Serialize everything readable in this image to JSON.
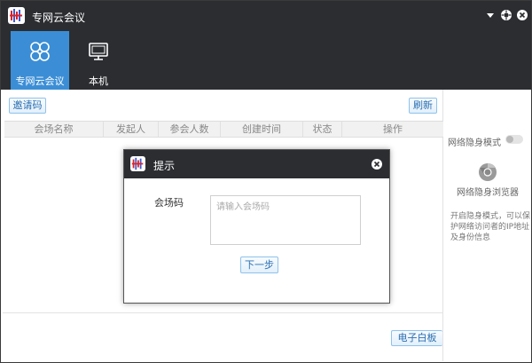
{
  "window": {
    "title": "专网云会议"
  },
  "nav": {
    "tabs": [
      {
        "label": "专网云会议",
        "icon": "meeting-cluster-icon",
        "active": true
      },
      {
        "label": "本机",
        "icon": "monitor-icon",
        "active": false
      }
    ]
  },
  "toolbar": {
    "invite_label": "邀请码",
    "refresh_label": "刷新"
  },
  "table": {
    "columns": [
      "会场名称",
      "发起人",
      "参会人数",
      "创建时间",
      "状态",
      "操作"
    ],
    "rows": []
  },
  "footer": {
    "whiteboard_label": "电子白板"
  },
  "right_panel": {
    "mode_label": "网络隐身模式",
    "mode_enabled": false,
    "browser_icon": "chrome-icon",
    "browser_label": "网络隐身浏览器",
    "description": "开启隐身模式，可以保护网络访问者的IP地址及身份信息"
  },
  "dialog": {
    "title": "提示",
    "field_label": "会场码",
    "field_placeholder": "请输入会场码",
    "field_value": "",
    "next_label": "下一步"
  },
  "colors": {
    "titlebar_bg": "#2b2d31",
    "accent": "#3b8ed6",
    "button_border": "#8fc2ea",
    "button_text": "#2b6fb0"
  }
}
